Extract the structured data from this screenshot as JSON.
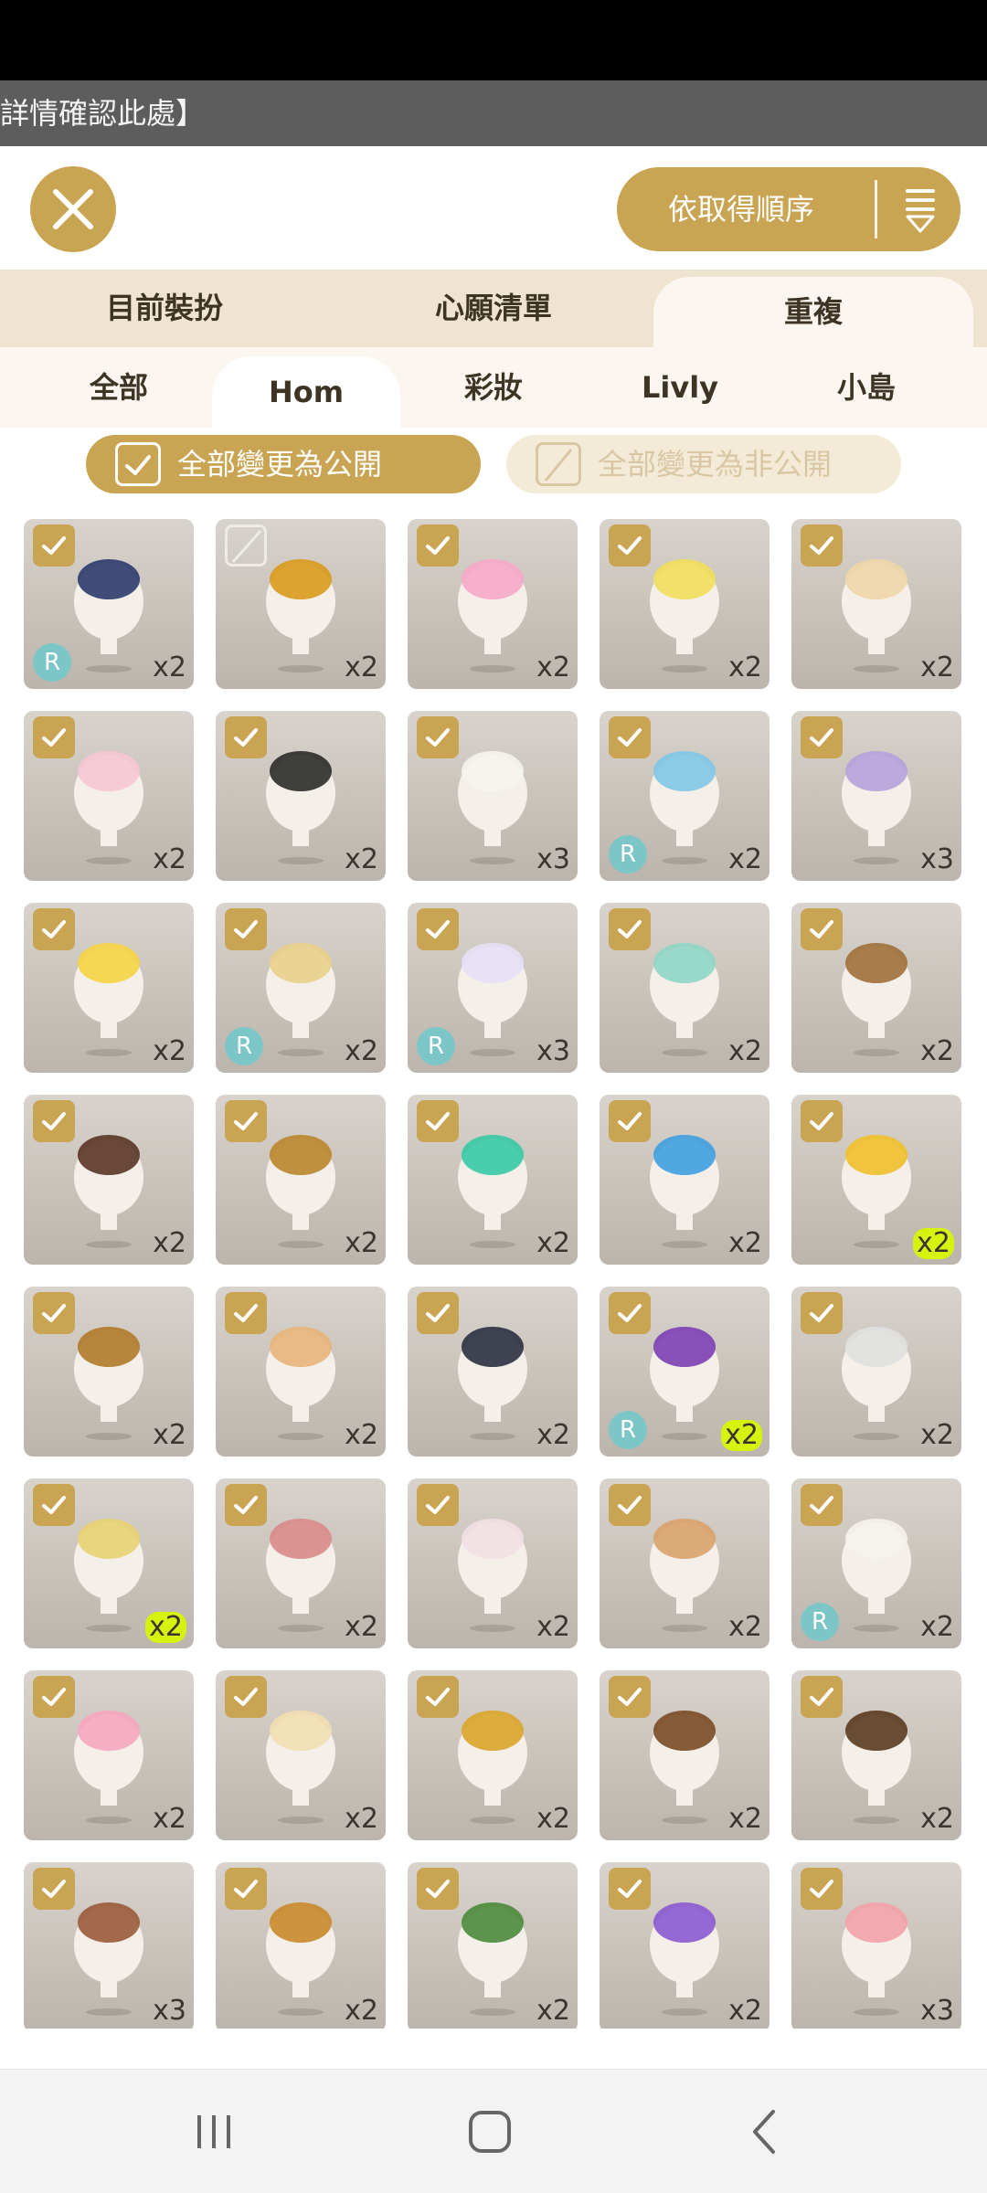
{
  "notice": {
    "text": "詳情確認此處】"
  },
  "topbar": {
    "sort_label": "依取得順序"
  },
  "tabs": [
    {
      "label": "目前裝扮",
      "active": false
    },
    {
      "label": "心願清單",
      "active": false
    },
    {
      "label": "重複",
      "active": true
    }
  ],
  "subtabs": [
    {
      "label": "全部",
      "active": false
    },
    {
      "label": "Hom",
      "active": true
    },
    {
      "label": "彩妝",
      "active": false
    },
    {
      "label": "Livly",
      "active": false
    },
    {
      "label": "小島",
      "active": false
    }
  ],
  "public_buttons": {
    "all_public": "全部變更為公開",
    "all_private": "全部變更為非公開"
  },
  "rare_badge": "R",
  "colors": {
    "accent": "#c9a452",
    "highlight": "#d6f20f",
    "rare": "#7cc6c8"
  },
  "items": [
    {
      "name": "navy-cape-outfit",
      "checked": true,
      "rare": true,
      "count": "x2",
      "color": "#2b3b6b"
    },
    {
      "name": "golden-moon-orb",
      "checked": false,
      "rare": false,
      "count": "x2",
      "color": "#d99a1c"
    },
    {
      "name": "easter-egg-ribbon",
      "checked": true,
      "rare": false,
      "count": "x2",
      "color": "#f6a9c9"
    },
    {
      "name": "yellow-knit-cap",
      "checked": true,
      "rare": false,
      "count": "x2",
      "color": "#f1de5b"
    },
    {
      "name": "straw-sun-hat",
      "checked": true,
      "rare": false,
      "count": "x2",
      "color": "#f0d6a8"
    },
    {
      "name": "bunny-ear-headband",
      "checked": true,
      "rare": false,
      "count": "x2",
      "color": "#f6c6d4"
    },
    {
      "name": "black-flower-shoes",
      "checked": true,
      "rare": false,
      "count": "x2",
      "color": "#2b2b2b"
    },
    {
      "name": "white-ruffle-blouse",
      "checked": true,
      "rare": false,
      "count": "x3",
      "color": "#f6f4f0"
    },
    {
      "name": "blue-flower-bouquet",
      "checked": true,
      "rare": true,
      "count": "x2",
      "color": "#7fc6e6"
    },
    {
      "name": "lavender-bouquet",
      "checked": true,
      "rare": false,
      "count": "x3",
      "color": "#b6a2dc"
    },
    {
      "name": "butterfly-hairpin",
      "checked": true,
      "rare": false,
      "count": "x2",
      "color": "#f6d444"
    },
    {
      "name": "alarm-clock",
      "checked": true,
      "rare": true,
      "count": "x2",
      "color": "#e9d08a"
    },
    {
      "name": "lilac-long-hair",
      "checked": true,
      "rare": true,
      "count": "x3",
      "color": "#e6e0f6"
    },
    {
      "name": "candy-headband",
      "checked": true,
      "rare": false,
      "count": "x2",
      "color": "#8fd6c6"
    },
    {
      "name": "brown-sandals",
      "checked": true,
      "rare": false,
      "count": "x2",
      "color": "#a0703a"
    },
    {
      "name": "brown-apron",
      "checked": true,
      "rare": false,
      "count": "x2",
      "color": "#5a3526"
    },
    {
      "name": "mustard-outfit",
      "checked": true,
      "rare": false,
      "count": "x2",
      "color": "#b9862c"
    },
    {
      "name": "green-short-hair",
      "checked": true,
      "rare": false,
      "count": "x2",
      "color": "#37c9a5"
    },
    {
      "name": "blue-hair-clip",
      "checked": true,
      "rare": false,
      "count": "x2",
      "color": "#3f9ee0"
    },
    {
      "name": "banana-peel-hat",
      "checked": true,
      "rare": false,
      "count": "x2",
      "highlight": true,
      "color": "#f0c02a"
    },
    {
      "name": "bronze-crown",
      "checked": true,
      "rare": false,
      "count": "x2",
      "color": "#b07a2a"
    },
    {
      "name": "biscuit-plate",
      "checked": true,
      "rare": false,
      "count": "x2",
      "color": "#e8b47a"
    },
    {
      "name": "dark-shorts",
      "checked": true,
      "rare": false,
      "count": "x2",
      "color": "#2b3040"
    },
    {
      "name": "purple-mushroom-cap",
      "checked": true,
      "rare": true,
      "count": "x2",
      "highlight": true,
      "color": "#7c3fb4"
    },
    {
      "name": "silver-earring",
      "checked": true,
      "rare": false,
      "count": "x2",
      "color": "#e0e0e0"
    },
    {
      "name": "plaid-skirt",
      "checked": true,
      "rare": false,
      "count": "x2",
      "highlight": true,
      "color": "#e8d272"
    },
    {
      "name": "candy-cane",
      "checked": true,
      "rare": false,
      "count": "x2",
      "color": "#d98a8a"
    },
    {
      "name": "sprinkle-hairband",
      "checked": true,
      "rare": false,
      "count": "x2",
      "color": "#f2dfe4"
    },
    {
      "name": "waffle-cone-dress",
      "checked": true,
      "rare": false,
      "count": "x2",
      "color": "#d9a26a"
    },
    {
      "name": "frosting-gloves",
      "checked": true,
      "rare": true,
      "count": "x2",
      "color": "#f6f2ee"
    },
    {
      "name": "pink-fluffy-hair",
      "checked": true,
      "rare": false,
      "count": "x2",
      "color": "#f6a6c0"
    },
    {
      "name": "blonde-short-hair",
      "checked": true,
      "rare": false,
      "count": "x2",
      "color": "#f2deb0"
    },
    {
      "name": "sun-mask",
      "checked": true,
      "rare": false,
      "count": "x2",
      "color": "#d9a52a"
    },
    {
      "name": "pudding-hat",
      "checked": true,
      "rare": false,
      "count": "x2",
      "color": "#7a4a24"
    },
    {
      "name": "brown-sunglasses",
      "checked": true,
      "rare": false,
      "count": "x2",
      "color": "#5a3a20"
    },
    {
      "name": "rope-bow",
      "checked": true,
      "rare": false,
      "count": "x3",
      "color": "#9a5a3a"
    },
    {
      "name": "acorn-lantern",
      "checked": true,
      "rare": false,
      "count": "x2",
      "color": "#c9892a"
    },
    {
      "name": "fruit-bonsai",
      "checked": true,
      "rare": false,
      "count": "x2",
      "color": "#4a8a3a"
    },
    {
      "name": "violet-flower-vase",
      "checked": true,
      "rare": false,
      "count": "x2",
      "color": "#8a5ad0"
    },
    {
      "name": "rose-flower-vase",
      "checked": true,
      "rare": false,
      "count": "x3",
      "color": "#f2a2a8"
    }
  ]
}
